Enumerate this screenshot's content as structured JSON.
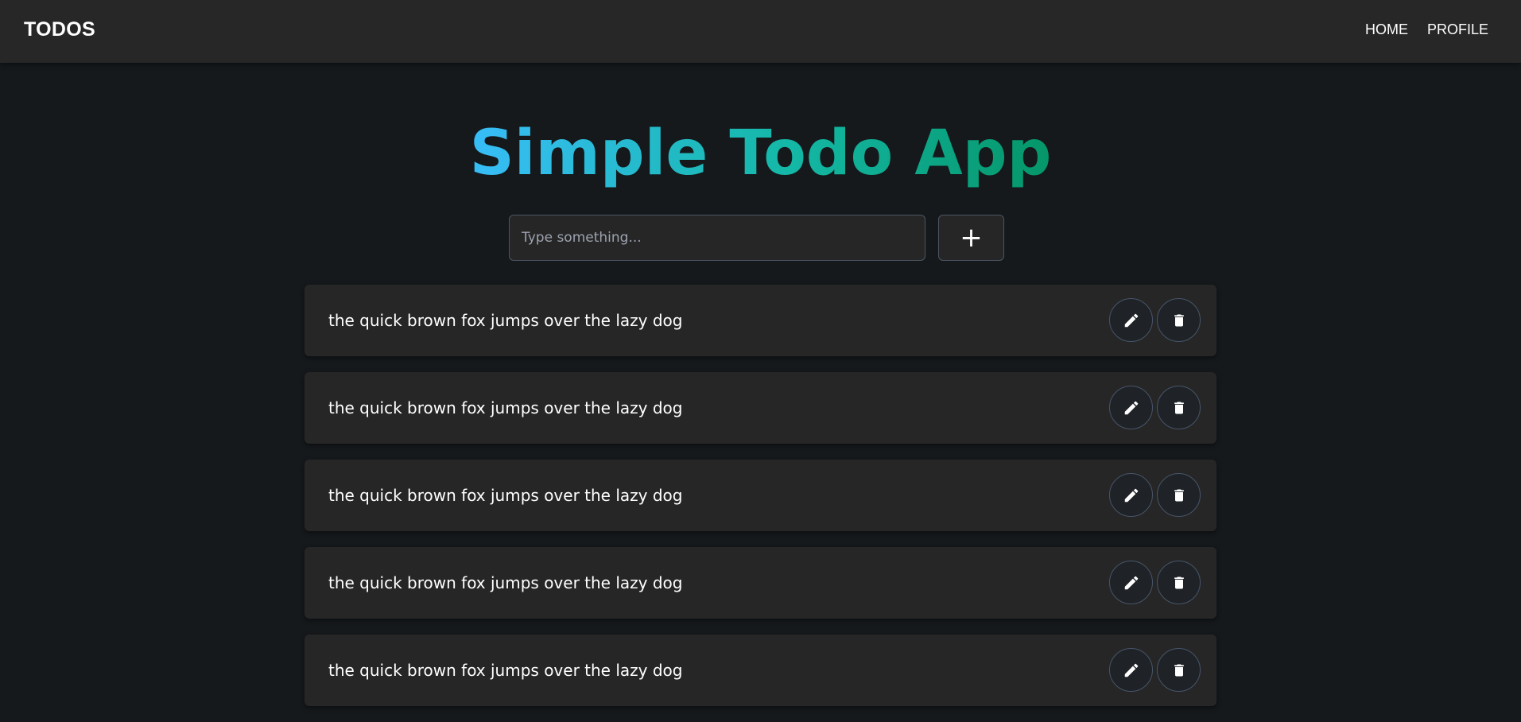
{
  "navbar": {
    "brand": "TODOS",
    "links": [
      {
        "label": "HOME"
      },
      {
        "label": "PROFILE"
      }
    ]
  },
  "main": {
    "title": "Simple Todo App",
    "title_gradient": [
      "#38bdf8",
      "#14b8a6",
      "#059669"
    ],
    "input": {
      "placeholder": "Type something...",
      "value": ""
    },
    "add_button_label": "+",
    "todos": [
      {
        "text": "the quick brown fox jumps over the lazy dog",
        "edit_icon": "pencil-icon",
        "delete_icon": "trash-icon"
      },
      {
        "text": "the quick brown fox jumps over the lazy dog",
        "edit_icon": "pencil-icon",
        "delete_icon": "trash-icon"
      },
      {
        "text": "the quick brown fox jumps over the lazy dog",
        "edit_icon": "pencil-icon",
        "delete_icon": "trash-icon"
      },
      {
        "text": "the quick brown fox jumps over the lazy dog",
        "edit_icon": "pencil-icon",
        "delete_icon": "trash-icon"
      },
      {
        "text": "the quick brown fox jumps over the lazy dog",
        "edit_icon": "pencil-icon",
        "delete_icon": "trash-icon"
      }
    ]
  },
  "colors": {
    "page_background": "#15191c",
    "navbar_background": "#272727",
    "card_background": "#262626",
    "text": "#ffffff",
    "placeholder": "#9ca3af"
  }
}
